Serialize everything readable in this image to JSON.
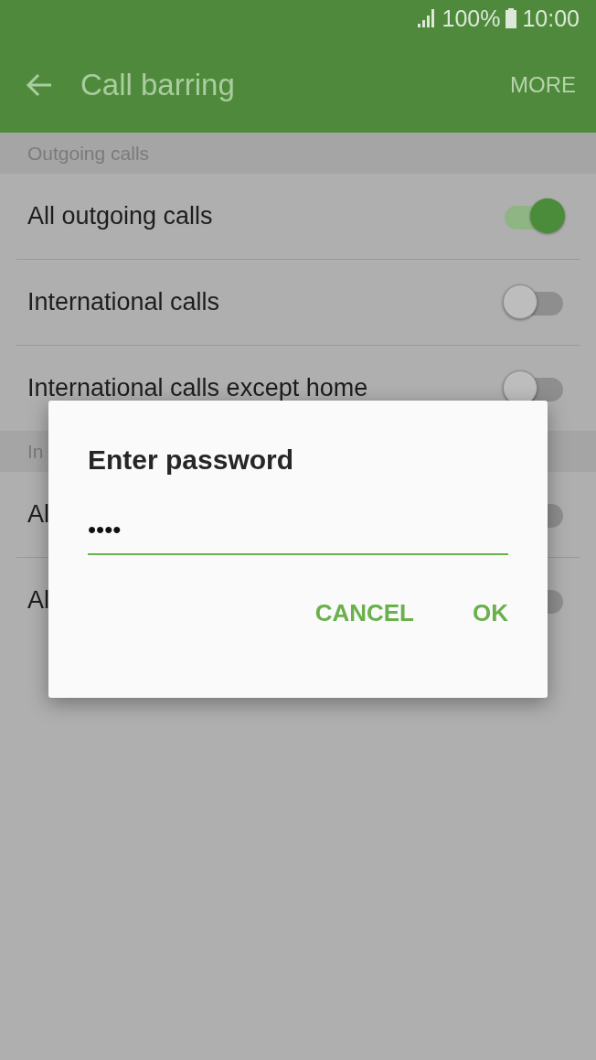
{
  "status_bar": {
    "battery": "100%",
    "time": "10:00"
  },
  "app_bar": {
    "title": "Call barring",
    "action": "MORE"
  },
  "sections": [
    {
      "header": "Outgoing calls",
      "items": [
        {
          "label": "All outgoing calls",
          "on": true
        },
        {
          "label": "International calls",
          "on": false
        },
        {
          "label": "International calls except home",
          "on": false
        }
      ]
    },
    {
      "header": "In",
      "items": [
        {
          "label": "Al",
          "on": false
        },
        {
          "label": "Al",
          "on": false
        }
      ]
    }
  ],
  "dialog": {
    "title": "Enter password",
    "password": {
      "value": "••••"
    },
    "buttons": [
      "CANCEL",
      "OK"
    ]
  }
}
